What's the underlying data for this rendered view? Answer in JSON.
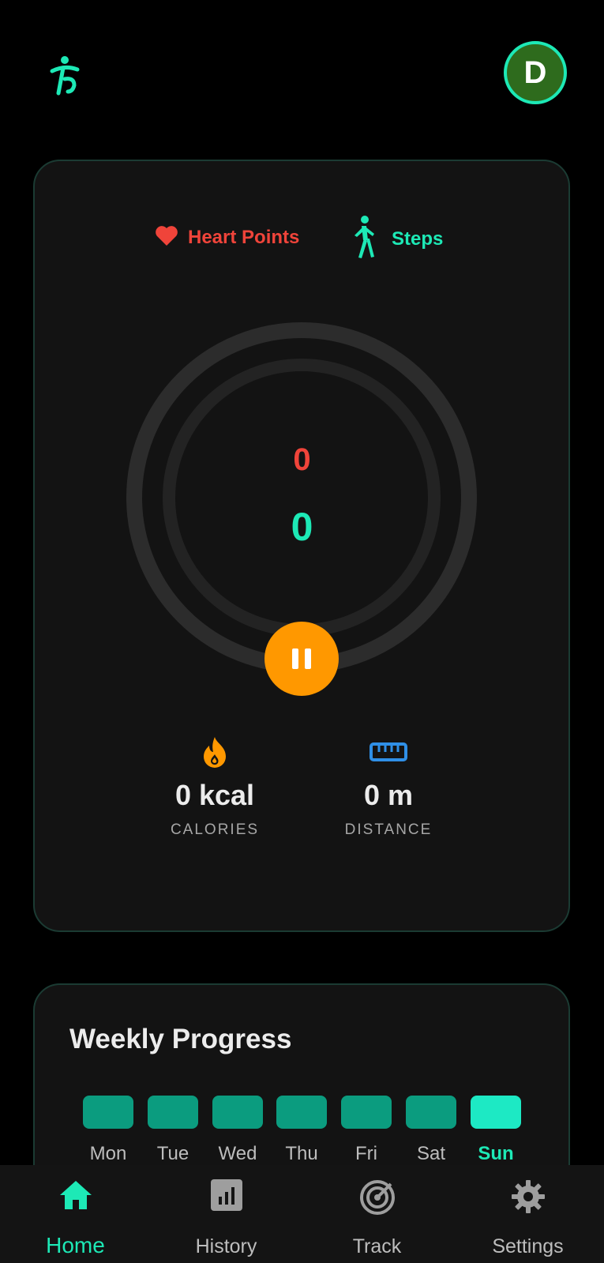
{
  "header": {
    "logo_icon": "walking-figure-logo-icon",
    "avatar_initial": "D"
  },
  "metrics": {
    "heart_points_label": "Heart Points",
    "steps_label": "Steps",
    "heart_points_value": "0",
    "steps_value": "0",
    "heart_points_color": "#f0443a",
    "steps_color": "#1de9b6",
    "pause_icon": "pause-icon"
  },
  "stats": {
    "calories_value": "0 kcal",
    "calories_label": "CALORIES",
    "calories_icon": "flame-icon",
    "distance_value": "0 m",
    "distance_label": "DISTANCE",
    "distance_icon": "ruler-icon"
  },
  "weekly": {
    "title": "Weekly Progress",
    "days": [
      {
        "label": "Mon",
        "active": false
      },
      {
        "label": "Tue",
        "active": false
      },
      {
        "label": "Wed",
        "active": false
      },
      {
        "label": "Thu",
        "active": false
      },
      {
        "label": "Fri",
        "active": false
      },
      {
        "label": "Sat",
        "active": false
      },
      {
        "label": "Sun",
        "active": true
      }
    ]
  },
  "nav": {
    "items": [
      {
        "label": "Home",
        "icon": "home-icon",
        "active": true
      },
      {
        "label": "History",
        "icon": "bar-chart-icon",
        "active": false
      },
      {
        "label": "Track",
        "icon": "target-icon",
        "active": false
      },
      {
        "label": "Settings",
        "icon": "gear-icon",
        "active": false
      }
    ]
  },
  "colors": {
    "accent": "#1de9b6",
    "orange": "#ff9800",
    "heart": "#f0443a"
  }
}
